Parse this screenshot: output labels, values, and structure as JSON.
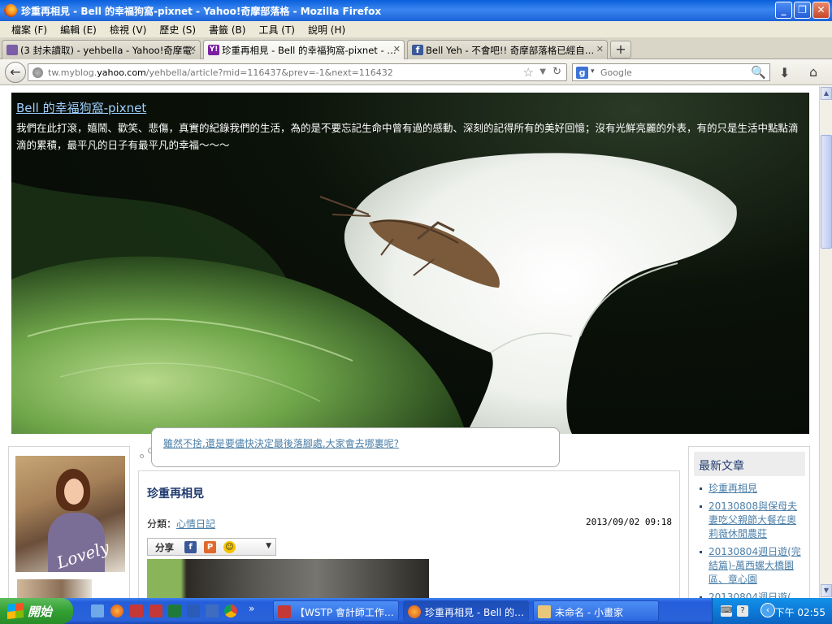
{
  "window": {
    "title": "珍重再相見 - Bell 的幸福狗窩-pixnet - Yahoo!奇摩部落格 - Mozilla Firefox",
    "minimize_label": "_",
    "maximize_label": "❐",
    "close_label": "✕"
  },
  "menu": {
    "items": [
      "檔案 (F)",
      "編輯 (E)",
      "檢視 (V)",
      "歷史 (S)",
      "書籤 (B)",
      "工具 (T)",
      "說明 (H)"
    ]
  },
  "tabs": [
    {
      "label": "(3 封未讀取) - yehbella - Yahoo!奇摩電…",
      "close": "✕"
    },
    {
      "label": "珍重再相見 - Bell 的幸福狗窩-pixnet - …",
      "close": "✕"
    },
    {
      "label": "Bell Yeh - 不會吧!! 奇摩部落格已經自…",
      "close": "✕"
    }
  ],
  "newtab_label": "+",
  "navbar": {
    "url_prefix": "tw.myblog.",
    "url_host": "yahoo.com",
    "url_rest": "/yehbella/article?mid=116437&prev=-1&next=116432",
    "search_placeholder": "Google",
    "search_engine_letter": "g",
    "back_glyph": "←",
    "star_glyph": "☆",
    "drop_glyph": "▼",
    "reload_glyph": "↻",
    "search_glyph": "🔍",
    "download_glyph": "⬇",
    "home_glyph": "⌂"
  },
  "blog": {
    "title": "Bell 的幸福狗窩-pixnet",
    "description": "我們在此打滾，嬉鬧、歡笑、悲傷，真實的紀錄我們的生活，為的是不要忘記生命中曾有過的感動、深刻的記得所有的美好回憶；沒有光鮮亮麗的外表，有的只是生活中點點滴滴的累積，最平凡的日子有最平凡的幸福～～～",
    "announcement": "雖然不捨,還是要儘快決定最後落腳處,大家會去哪裏呢?",
    "avatar_signature": "Lovely"
  },
  "post": {
    "title": "珍重再相見",
    "category_label": "分類：",
    "category_link": "心情日記",
    "date": "2013/09/02 09:18",
    "share_label": "分享",
    "share_icons": [
      "facebook-icon",
      "plurk-icon",
      "emoticon-icon"
    ]
  },
  "sidebar": {
    "heading": "最新文章",
    "items": [
      "珍重再相見",
      "20130808與保母夫妻吃父親節大餐在奧莉薇休閒農莊",
      "20130804週日遊(完結篇)-萬西螺大橋園區、章心園",
      "20130804週日遊("
    ]
  },
  "taskbar": {
    "start_label": "開始",
    "tasks": [
      "【WSTP 會計師工作…",
      "珍重再相見 - Bell 的…",
      "未命名 - 小畫家"
    ],
    "clock": "下午 02:55",
    "more_glyph": "»",
    "tray_chevron": "‹"
  },
  "colors": {
    "titlebar": "#0a5fdc",
    "link": "#4c7fa8",
    "heading": "#1e3a6e",
    "taskbar": "#245edb",
    "start": "#33a033"
  }
}
